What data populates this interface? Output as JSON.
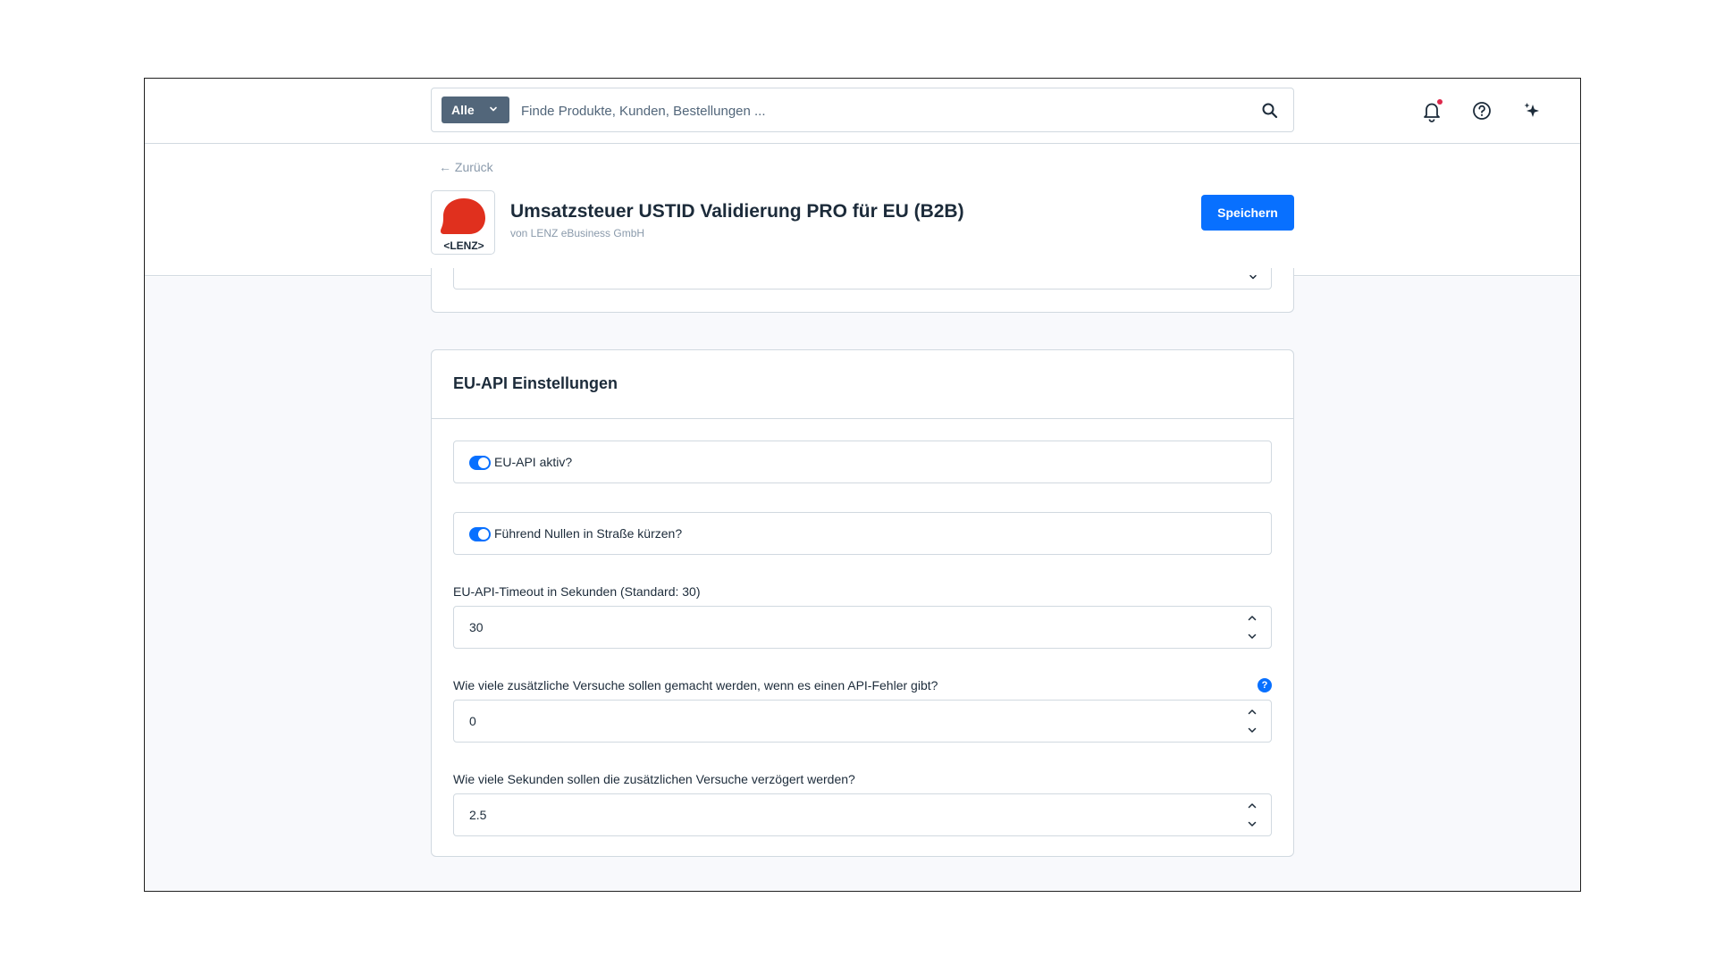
{
  "topbar": {
    "scope_label": "Alle",
    "search_placeholder": "Finde Produkte, Kunden, Bestellungen ..."
  },
  "header": {
    "back_label": "← Zurück",
    "title": "Umsatzsteuer USTID Validierung PRO für EU (B2B)",
    "subtitle": "von LENZ eBusiness GmbH",
    "save_label": "Speichern",
    "logo_text": "<LENZ>"
  },
  "card": {
    "title": "EU-API Einstellungen",
    "switches": [
      {
        "label": "EU-API aktiv?",
        "checked": true
      },
      {
        "label": "Führend Nullen in Straße kürzen?",
        "checked": true
      }
    ],
    "fields": [
      {
        "label": "EU-API-Timeout in Sekunden (Standard: 30)",
        "value": "30",
        "help": false
      },
      {
        "label": "Wie viele zusätzliche Versuche sollen gemacht werden, wenn es einen API-Fehler gibt?",
        "value": "0",
        "help": true,
        "help_glyph": "?"
      },
      {
        "label": "Wie viele Sekunden sollen die zusätzlichen Versuche verzögert werden?",
        "value": "2.5",
        "help": false
      }
    ]
  },
  "colors": {
    "accent": "#0870ff",
    "scope_bg": "#52667a",
    "logo_red": "#e0301e",
    "notification_dot": "#de294c"
  }
}
